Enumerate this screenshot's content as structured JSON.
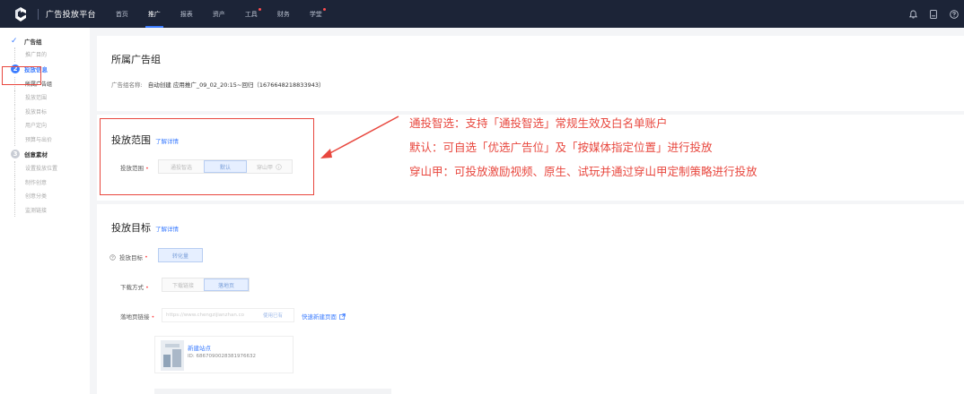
{
  "app": {
    "brand": "广告投放平台"
  },
  "nav": {
    "items": [
      {
        "label": "首页"
      },
      {
        "label": "推广"
      },
      {
        "label": "报表"
      },
      {
        "label": "资产"
      },
      {
        "label": "工具"
      },
      {
        "label": "财务"
      },
      {
        "label": "学堂"
      }
    ],
    "active": "推广"
  },
  "sidebar": {
    "step1": {
      "title": "广告组",
      "subs": [
        "推广目的"
      ]
    },
    "step2": {
      "num": "2",
      "title": "投放信息",
      "subs": [
        "所属广告组",
        "投放范围",
        "投放目标",
        "用户定向",
        "预算与出价"
      ]
    },
    "step3": {
      "num": "3",
      "title": "创意素材",
      "subs": [
        "设置投放位置",
        "制作创意",
        "创意分类",
        "监测链接"
      ]
    }
  },
  "group": {
    "title": "所属广告组",
    "name_label": "广告组名称:",
    "name_value": "自动创建 应用推广_09_02_20:15~回归（1676648218833943）"
  },
  "scope": {
    "title": "投放范围",
    "detail_link": "了解详情",
    "field_label": "投放范围",
    "options": [
      "通投智选",
      "默认",
      "穿山甲"
    ],
    "selected": "默认"
  },
  "target": {
    "title": "投放目标",
    "detail_link": "了解详情",
    "goal_label": "投放目标",
    "goal_value": "转化量",
    "download_label": "下载方式",
    "download_options": [
      "下载链接",
      "落地页"
    ],
    "download_selected": "落地页",
    "landing_label": "落地页链接",
    "landing_placeholder": "https://www.chengzijianzhan.co",
    "use_existing": "使用已有",
    "quick_create": "快速新建页面",
    "site_name": "新建站点",
    "site_id": "ID: 6867090028381976632"
  },
  "annotation": {
    "lines": [
      "通投智选：支持「通投智选」常规生效及白名单账户",
      "默认：可自选「优选广告位」及「按媒体指定位置」进行投放",
      "穿山甲：可投放激励视频、原生、试玩并通过穿山甲定制策略进行投放"
    ],
    "color": "#e8473e"
  },
  "colors": {
    "nav_bg": "#1c2437",
    "accent": "#3b7cff",
    "annotation": "#e8473e"
  }
}
